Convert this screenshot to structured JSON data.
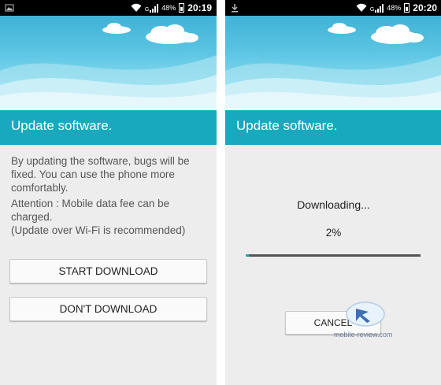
{
  "left_screen": {
    "status_bar": {
      "battery_percent": "48%",
      "time": "20:19",
      "network_letter": "G"
    },
    "title": "Update software.",
    "description": "By updating the software, bugs will be fixed. You can use the phone more comfortably.",
    "attention": "Attention : Mobile data fee can be charged.",
    "wifi_note": "(Update over Wi-Fi is recommended)",
    "start_button": "START DOWNLOAD",
    "dont_button": "DON'T DOWNLOAD"
  },
  "right_screen": {
    "status_bar": {
      "battery_percent": "48%",
      "time": "20:20",
      "network_letter": "G"
    },
    "title": "Update software.",
    "download_status": "Downloading...",
    "download_percent": "2%",
    "progress_fraction": 0.02,
    "cancel_button": "CANCEL"
  },
  "watermark": {
    "text": "mobile-review.com"
  },
  "colors": {
    "accent": "#19a9bf",
    "status_bar": "#000000",
    "background": "#ededed"
  }
}
